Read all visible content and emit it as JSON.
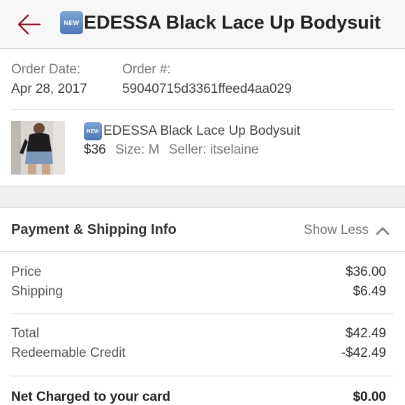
{
  "header": {
    "badge": "NEW",
    "title": "EDESSA Black Lace Up Bodysuit"
  },
  "order": {
    "date_label": "Order Date:",
    "date_value": "Apr 28, 2017",
    "number_label": "Order #:",
    "number_value": "59040715d3361ffeed4aa029"
  },
  "item": {
    "badge": "NEW",
    "title": "EDESSA Black Lace Up Bodysuit",
    "price": "$36",
    "size": "Size: M",
    "seller": "Seller: itselaine"
  },
  "payment": {
    "title": "Payment & Shipping Info",
    "toggle_label": "Show Less",
    "rows": [
      {
        "label": "Price",
        "amount": "$36.00"
      },
      {
        "label": "Shipping",
        "amount": "$6.49"
      },
      {
        "label": "Total",
        "amount": "$42.49"
      },
      {
        "label": "Redeemable Credit",
        "amount": "-$42.49"
      }
    ],
    "net": {
      "label": "Net Charged to your card",
      "amount": "$0.00"
    }
  },
  "colors": {
    "accent": "#8b1a2b",
    "badge": "#5a82bd"
  }
}
